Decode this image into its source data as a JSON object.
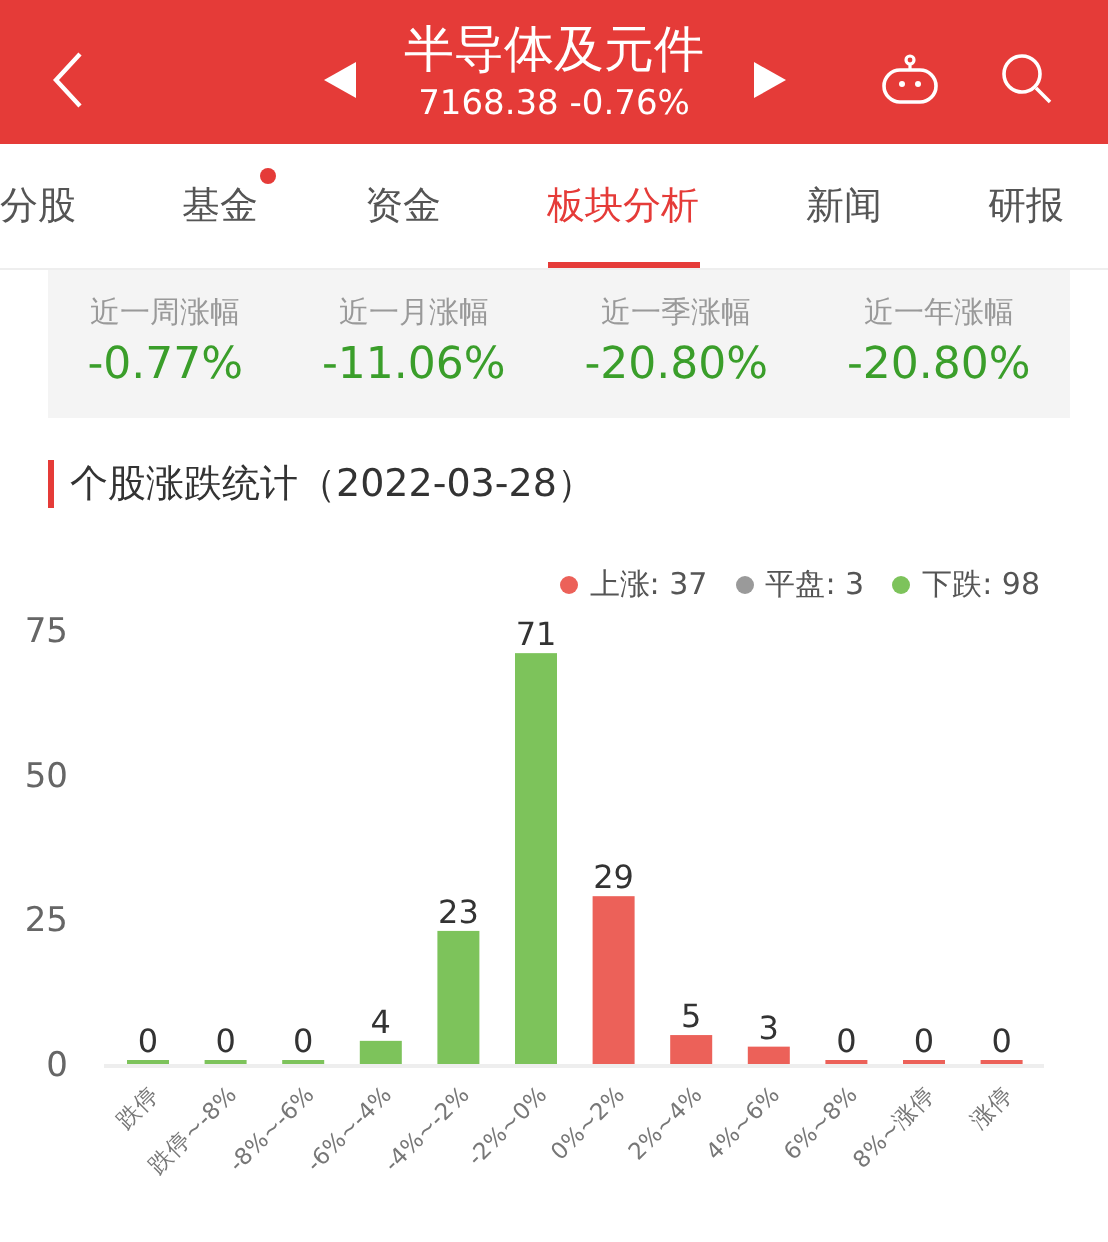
{
  "header": {
    "title": "半导体及元件",
    "quote": "7168.38 -0.76%"
  },
  "tabs": [
    {
      "label": "分股",
      "selected": false,
      "dot": false
    },
    {
      "label": "基金",
      "selected": false,
      "dot": true
    },
    {
      "label": "资金",
      "selected": false,
      "dot": false
    },
    {
      "label": "板块分析",
      "selected": true,
      "dot": false
    },
    {
      "label": "新闻",
      "selected": false,
      "dot": false
    },
    {
      "label": "研报",
      "selected": false,
      "dot": false
    }
  ],
  "returns": [
    {
      "label": "近一周涨幅",
      "value": "-0.77%"
    },
    {
      "label": "近一月涨幅",
      "value": "-11.06%"
    },
    {
      "label": "近一季涨幅",
      "value": "-20.80%"
    },
    {
      "label": "近一年涨幅",
      "value": "-20.80%"
    }
  ],
  "section": {
    "title": "个股涨跌统计（2022-03-28）"
  },
  "legend": [
    {
      "label": "上涨: 37",
      "color": "#ec6159"
    },
    {
      "label": "平盘: 3",
      "color": "#9a9a9a"
    },
    {
      "label": "下跌: 98",
      "color": "#7dc35b"
    }
  ],
  "chart_data": {
    "type": "bar",
    "categories": [
      "跌停",
      "跌停~-8%",
      "-8%~-6%",
      "-6%~-4%",
      "-4%~-2%",
      "-2%~0%",
      "0%~2%",
      "2%~4%",
      "4%~6%",
      "6%~8%",
      "8%~涨停",
      "涨停"
    ],
    "series": [
      {
        "color": "#7dc35b",
        "values": [
          0,
          0,
          0,
          4,
          23,
          71,
          null,
          null,
          null,
          null,
          null,
          null
        ]
      },
      {
        "color": "#ec6159",
        "values": [
          null,
          null,
          null,
          null,
          null,
          null,
          29,
          5,
          3,
          0,
          0,
          0
        ]
      }
    ],
    "stacked": true,
    "ylim": [
      0,
      75
    ],
    "yticks": [
      0,
      25,
      50,
      75
    ],
    "data_labels": true
  }
}
